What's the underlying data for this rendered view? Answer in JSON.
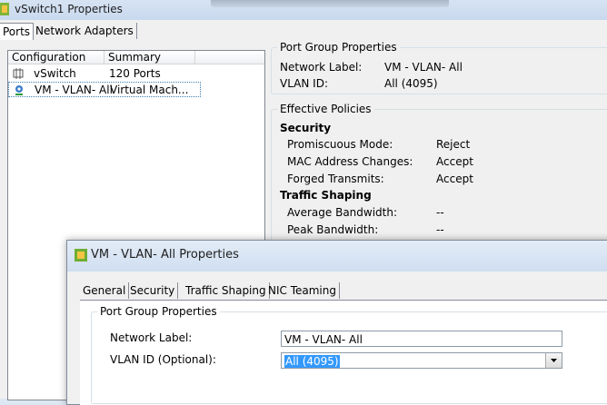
{
  "back_window": {
    "title": "vSwitch1 Properties",
    "tabs": [
      {
        "label": "Ports",
        "active": true
      },
      {
        "label": "Network Adapters",
        "active": false
      }
    ],
    "list": {
      "columns": [
        "Configuration",
        "Summary"
      ],
      "rows": [
        {
          "name": "vSwitch",
          "summary": "120 Ports",
          "icon": "vswitch-icon",
          "selected": false
        },
        {
          "name": "VM - VLAN- All",
          "summary": "Virtual Mach...",
          "icon": "port-group-icon",
          "selected": true
        }
      ]
    },
    "port_group_properties": {
      "legend": "Port Group Properties",
      "network_label_key": "Network Label:",
      "network_label_value": "VM - VLAN- All",
      "vlan_id_key": "VLAN ID:",
      "vlan_id_value": "All (4095)"
    },
    "effective_policies": {
      "legend": "Effective Policies",
      "security_heading": "Security",
      "promiscuous_key": "Promiscuous Mode:",
      "promiscuous_value": "Reject",
      "mac_changes_key": "MAC Address Changes:",
      "mac_changes_value": "Accept",
      "forged_key": "Forged Transmits:",
      "forged_value": "Accept",
      "traffic_heading": "Traffic Shaping",
      "avg_bw_key": "Average Bandwidth:",
      "avg_bw_value": "--",
      "peak_bw_key": "Peak Bandwidth:",
      "peak_bw_value": "--"
    }
  },
  "dialog": {
    "title": "VM - VLAN- All Properties",
    "tabs": [
      {
        "label": "General",
        "active": true
      },
      {
        "label": "Security",
        "active": false
      },
      {
        "label": "Traffic Shaping",
        "active": false
      },
      {
        "label": "NIC Teaming",
        "active": false
      }
    ],
    "group_legend": "Port Group Properties",
    "network_label_field_label": "Network Label:",
    "network_label_value": "VM - VLAN- All",
    "vlan_field_label": "VLAN ID (Optional):",
    "vlan_value": "All (4095)"
  }
}
